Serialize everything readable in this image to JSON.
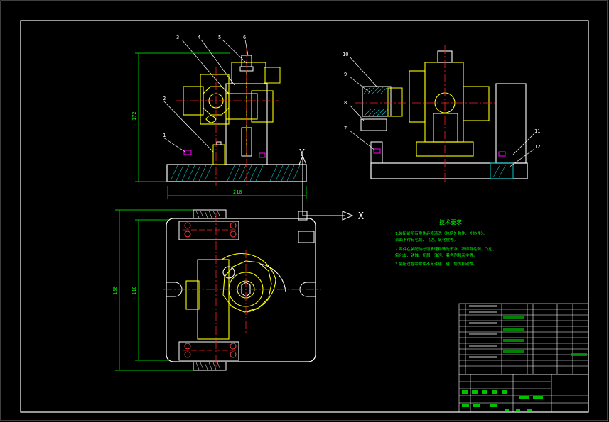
{
  "drawing": {
    "views": [
      "front-view",
      "side-view",
      "top-view"
    ],
    "balloon_labels": [
      "1",
      "2",
      "3",
      "4",
      "5",
      "6",
      "7",
      "8",
      "9",
      "10",
      "11",
      "12"
    ],
    "dimensions": {
      "front_height": "172",
      "front_width": "210",
      "top_outer_height": "130",
      "top_inner_height": "110"
    },
    "ucs": {
      "y_label": "Y",
      "x_label": "X"
    },
    "technical_notes": {
      "title": "技术要求",
      "lines": [
        "1.装配前所有零件必须清洗（包括外购件、外协件），",
        "  表面不得有毛刺、飞边、氧化皮等。",
        "2.零件在装配前必须清理和清洗干净，不得有毛刺、飞边、",
        "  氧化皮、锈蚀、切屑、油污、着色剂和灰尘等。",
        "3.装配过程中零件不允许磕、碰、划伤和锈蚀。"
      ]
    },
    "colors": {
      "background": "#000000",
      "outline": "#ffffff",
      "part": "#ffff00",
      "centerline": "#ff0000",
      "dimension": "#00ff00",
      "hatch": "#00ffff",
      "accent": "#ff00ff"
    }
  }
}
